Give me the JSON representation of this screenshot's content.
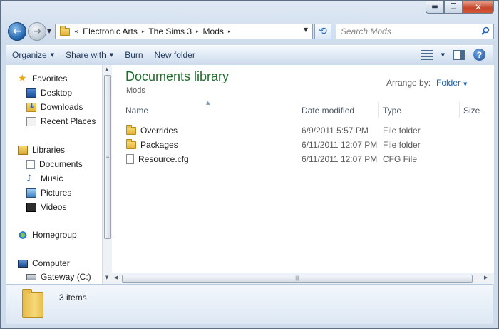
{
  "window": {
    "caption": {
      "minimize": "▬",
      "maximize": "❐",
      "close": "✕"
    }
  },
  "address": {
    "overflow": "«",
    "crumbs": [
      "Electronic Arts",
      "The Sims 3",
      "Mods"
    ],
    "chevron": "▸",
    "search_placeholder": "Search Mods"
  },
  "toolbar": {
    "organize": "Organize",
    "share_with": "Share with",
    "burn": "Burn",
    "new_folder": "New folder",
    "help": "?"
  },
  "nav": {
    "favorites": "Favorites",
    "desktop": "Desktop",
    "downloads": "Downloads",
    "recent_places": "Recent Places",
    "libraries": "Libraries",
    "documents": "Documents",
    "music": "Music",
    "pictures": "Pictures",
    "videos": "Videos",
    "homegroup": "Homegroup",
    "computer": "Computer",
    "drive": "Gateway (C:)"
  },
  "content": {
    "title": "Documents library",
    "subtitle": "Mods",
    "arrange_label": "Arrange by:",
    "arrange_value": "Folder",
    "columns": {
      "name": "Name",
      "date": "Date modified",
      "type": "Type",
      "size": "Size"
    },
    "rows": [
      {
        "name": "Overrides",
        "date": "6/9/2011 5:57 PM",
        "type": "File folder",
        "icon": "folder-icon"
      },
      {
        "name": "Packages",
        "date": "6/11/2011 12:07 PM",
        "type": "File folder",
        "icon": "folder-icon"
      },
      {
        "name": "Resource.cfg",
        "date": "6/11/2011 12:07 PM",
        "type": "CFG File",
        "icon": "file-icon"
      }
    ]
  },
  "details": {
    "count": "3 items"
  }
}
